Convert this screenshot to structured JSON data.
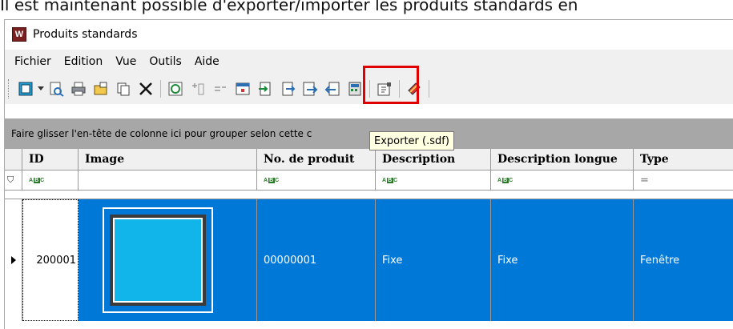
{
  "caption": "Il est maintenant possible d'exporter/importer les produits standards en",
  "window": {
    "title": "Produits standards",
    "app_icon_letter": "W"
  },
  "menu": [
    "Fichier",
    "Edition",
    "Vue",
    "Outils",
    "Aide"
  ],
  "toolbar": {
    "icons": [
      "new-icon",
      "dropdown-arrow-icon",
      "preview-icon",
      "print-icon",
      "open-folder-icon",
      "copy-icon",
      "delete-icon",
      "refresh-icon",
      "add-column-icon",
      "list-icon",
      "calendar-icon",
      "import-file-icon",
      "export-file-icon",
      "export-sdf-icon",
      "import-sdf-icon",
      "calculator-icon",
      "properties-icon",
      "help-book-icon"
    ],
    "highlight_color": "#e00000"
  },
  "group_panel": {
    "text": "Faire glisser l'en-tête de colonne ici pour grouper selon cette c"
  },
  "tooltip": {
    "text": "Exporter (.sdf)"
  },
  "grid": {
    "columns": [
      "ID",
      "Image",
      "No. de produit",
      "Description",
      "Description longue",
      "Type"
    ],
    "filter_row": {
      "text_filter_glyph": "ABC",
      "type_filter_glyph": "="
    },
    "rows": [
      {
        "id": "200001",
        "product_no": "00000001",
        "description": "Fixe",
        "long_description": "Fixe",
        "type": "Fenêtre"
      }
    ],
    "selection_color": "#0078d7"
  }
}
